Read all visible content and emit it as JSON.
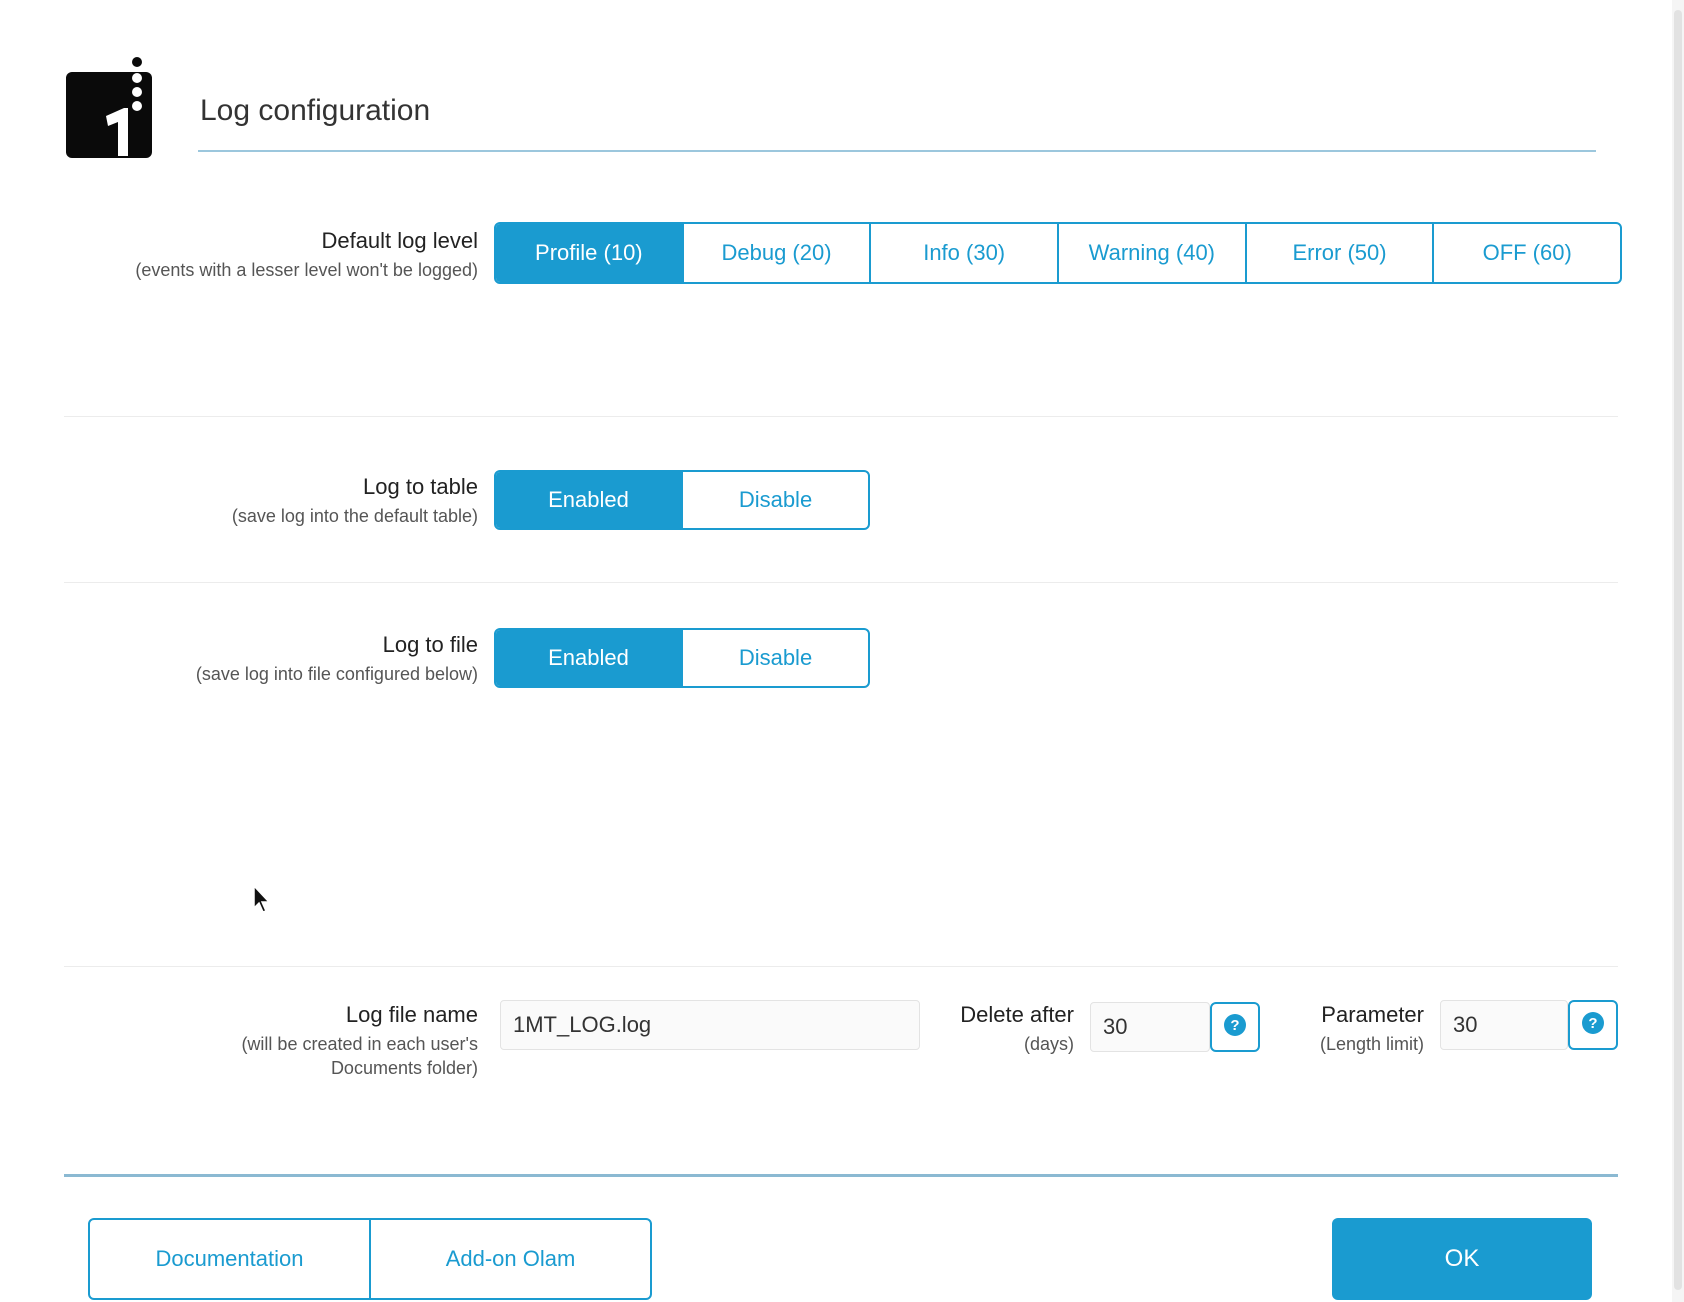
{
  "header": {
    "title": "Log configuration"
  },
  "log_level": {
    "label": "Default log level",
    "sublabel": "(events with a lesser level won't be logged)",
    "options": [
      "Profile (10)",
      "Debug (20)",
      "Info (30)",
      "Warning (40)",
      "Error (50)",
      "OFF (60)"
    ],
    "selected": "Profile (10)"
  },
  "log_table": {
    "label": "Log to table",
    "sublabel": "(save log into the default table)",
    "enabled_label": "Enabled",
    "disable_label": "Disable",
    "selected": "Enabled"
  },
  "log_file": {
    "label": "Log to file",
    "sublabel": "(save log into file configured below)",
    "enabled_label": "Enabled",
    "disable_label": "Disable",
    "selected": "Enabled"
  },
  "file_settings": {
    "name_label": "Log file name",
    "name_sub1": "(will be created in each user's",
    "name_sub2": "Documents folder)",
    "name_value": "1MT_LOG.log",
    "delete_label": "Delete after",
    "delete_sub": "(days)",
    "delete_value": "30",
    "param_label": "Parameter",
    "param_sub": "(Length limit)",
    "param_value": "30"
  },
  "footer": {
    "documentation_label": "Documentation",
    "addon_label": "Add-on Olam",
    "ok_label": "OK"
  },
  "colors": {
    "accent": "#1a9bd0",
    "rule": "#9cc7dd"
  }
}
